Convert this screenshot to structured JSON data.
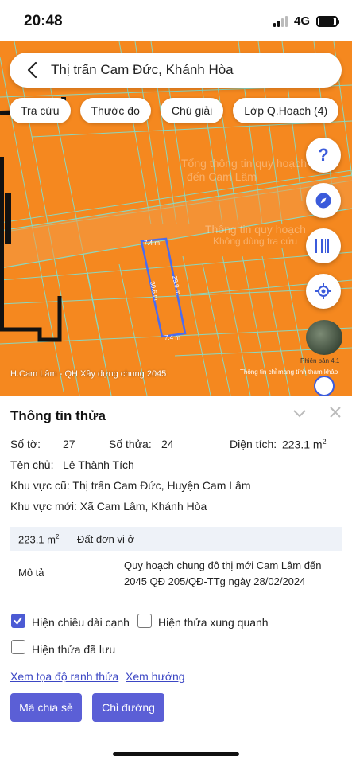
{
  "status_bar": {
    "time": "20:48",
    "network": "4G",
    "battery_level": 0.9
  },
  "header": {
    "title": "Thị trấn Cam Đức, Khánh Hòa"
  },
  "chips": [
    {
      "label": "Tra cứu"
    },
    {
      "label": "Thước đo"
    },
    {
      "label": "Chú giải"
    },
    {
      "label": "Lớp Q.Hoạch (4)"
    }
  ],
  "map": {
    "lot_edges": {
      "top": "7.4 m",
      "bottom": "7.4 m",
      "left": "30.6 m",
      "right": "29.9 m"
    },
    "version_label": "Phiên bản 4.1",
    "credit_left": "H.Cam Lâm - QH Xây dựng chung 2045",
    "credit_right": "Thông tin chỉ mang tính tham khảo",
    "watermark_1": "Tổng thông tin quy hoạch",
    "watermark_2": "đến Cam Lâm",
    "watermark_3": "Thông tin quy hoạch",
    "watermark_4": "Không dùng tra cứu",
    "fab_icons": [
      "help-icon",
      "compass-icon",
      "barcode-icon",
      "locate-icon"
    ],
    "colors": {
      "zone": "#f5881f",
      "lot_outline": "#4a6cf0"
    }
  },
  "panel": {
    "title": "Thông tin thửa",
    "so_to_label": "Số tờ:",
    "so_to_value": "27",
    "so_thua_label": "Số thửa:",
    "so_thua_value": "24",
    "dien_tich_label": "Diện tích:",
    "dien_tich_value": "223.1 m",
    "dien_tich_sup": "2",
    "ten_chu_label": "Tên chủ:",
    "ten_chu_value": "Lê Thành Tích",
    "kv_cu_label": "Khu vực cũ:",
    "kv_cu_value": "Thị trấn Cam Đức, Huyện Cam Lâm",
    "kv_moi_label": "Khu vực mới:",
    "kv_moi_value": "Xã Cam Lâm, Khánh Hòa",
    "table": {
      "area": "223.1 m",
      "area_sup": "2",
      "land_type": "Đất đơn vị ở",
      "desc_label": "Mô tả",
      "desc_line1": "Quy hoạch chung đô thị mới Cam Lâm đến",
      "desc_line2": "2045 QĐ 205/QĐ-TTg ngày 28/02/2024"
    },
    "options": {
      "show_edge_length": "Hiện chiều dài cạnh",
      "show_neighbors": "Hiện thửa xung quanh",
      "show_saved": "Hiện thửa đã lưu"
    },
    "links": {
      "boundary_coords": "Xem tọa độ ranh thửa",
      "direction": "Xem hướng"
    },
    "buttons": {
      "share_code": "Mã chia sẻ",
      "directions": "Chỉ đường"
    }
  }
}
